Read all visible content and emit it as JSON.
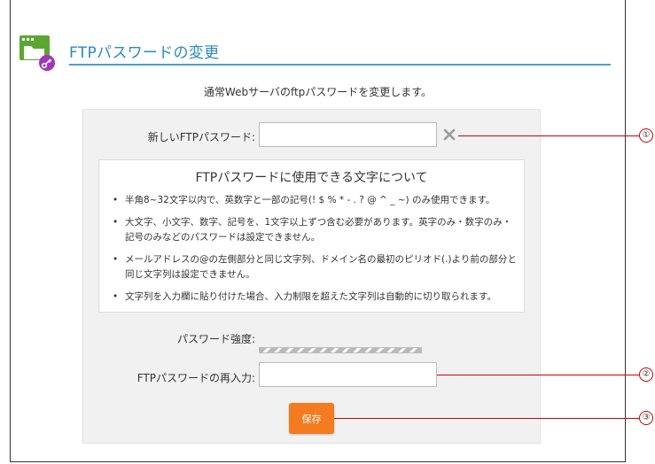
{
  "header": {
    "title": "FTPパスワードの変更"
  },
  "intro": "通常Webサーバのftpパスワードを変更します。",
  "form": {
    "password_label": "新しいFTPパスワード:",
    "password_value": "",
    "strength_label": "パスワード強度:",
    "strength_level": 0,
    "reenter_label": "FTPパスワードの再入力:",
    "reenter_value": "",
    "save_label": "保存"
  },
  "rules": {
    "title": "FTPパスワードに使用できる文字について",
    "items": [
      "半角8~32文字以内で、英数字と一部の記号(! $ % * - . ? @ ^ _ ~) のみ使用できます。",
      "大文字、小文字、数字、記号を、1文字以上ずつ含む必要があります。英字のみ・数字のみ・記号のみなどのパスワードは設定できません。",
      "メールアドレスの@の左側部分と同じ文字列、ドメイン名の最初のピリオド(.)より前の部分と同じ文字列は設定できません。",
      "文字列を入力欄に貼り付けた場合、入力制限を超えた文字列は自動的に切り取られます。"
    ]
  },
  "callouts": [
    "①",
    "②",
    "③"
  ],
  "colors": {
    "accent": "#2a8ac4",
    "save_button": "#f47b20",
    "callout": "#cc0000"
  }
}
